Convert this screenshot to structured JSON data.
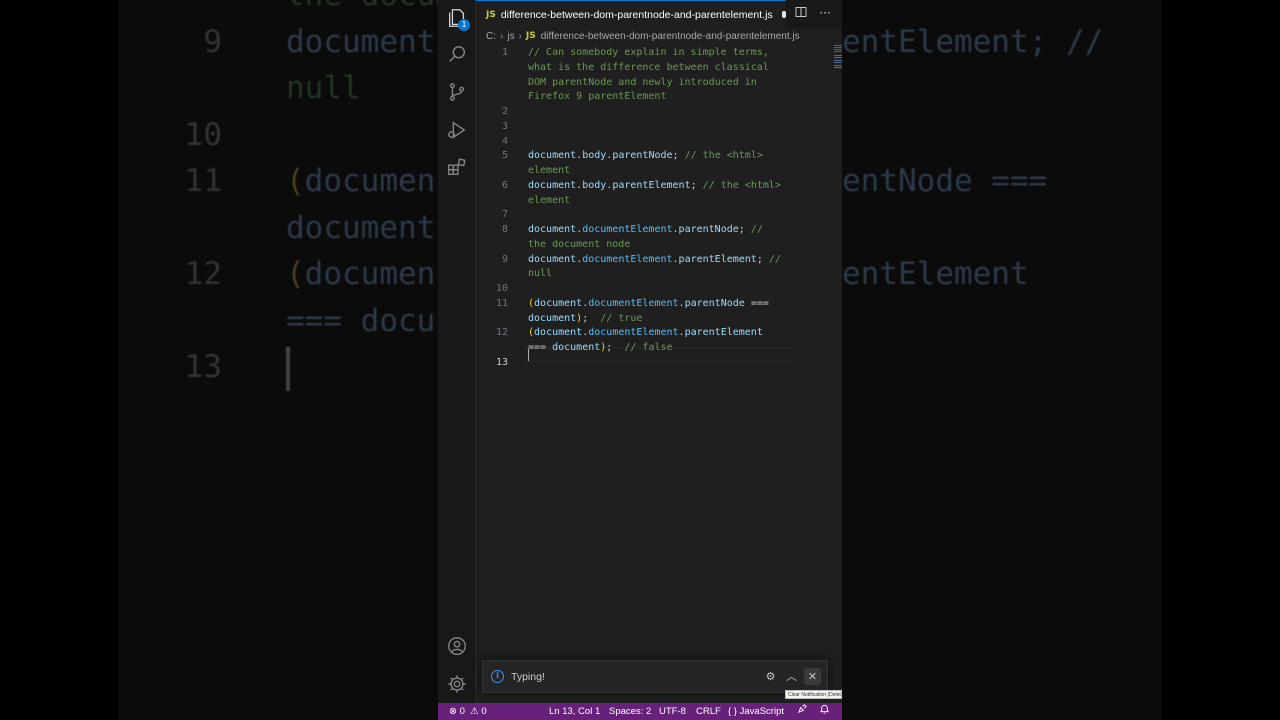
{
  "background": {
    "lines": [
      {
        "ln": "",
        "text": "the docum",
        "kind": "com"
      },
      {
        "ln": "9",
        "text": "document",
        "kind": "var"
      },
      {
        "ln": "",
        "text": "null",
        "kind": "com"
      },
      {
        "ln": "10",
        "text": "",
        "kind": "var"
      },
      {
        "ln": "11",
        "text": "(documen",
        "kind": "var"
      },
      {
        "ln": "",
        "text": "document",
        "kind": "var"
      },
      {
        "ln": "12",
        "text": "(documen",
        "kind": "var"
      },
      {
        "ln": "",
        "text": "=== docu",
        "kind": "var"
      },
      {
        "ln": "13",
        "text": "",
        "kind": "cursor"
      }
    ],
    "right_lines": [
      "",
      "entElement; //",
      "",
      "",
      "entNode ===",
      "",
      "entElement",
      "",
      ""
    ]
  },
  "tab": {
    "lang_badge": "JS",
    "title": "difference-between-dom-parentnode-and-parentelement.js",
    "split_icon": "split-editor-icon",
    "more_icon": "more-actions-icon"
  },
  "breadcrumb": {
    "drive": "C:",
    "folder": "js",
    "lang_badge": "JS",
    "file": "difference-between-dom-parentnode-and-parentelement.js"
  },
  "activity_bar": {
    "explorer_badge": "1",
    "icons": [
      "explorer-icon",
      "search-icon",
      "source-control-icon",
      "run-debug-icon",
      "extensions-icon"
    ],
    "bottom_icons": [
      "account-icon",
      "manage-gear-icon"
    ]
  },
  "editor": {
    "lines": [
      {
        "ln": "1",
        "tokens": [
          {
            "t": "// Can somebody explain in simple terms,",
            "c": "com"
          }
        ]
      },
      {
        "ln": "",
        "tokens": [
          {
            "t": "what is the difference between classical",
            "c": "com"
          }
        ]
      },
      {
        "ln": "",
        "tokens": [
          {
            "t": "DOM parentNode and newly introduced in",
            "c": "com"
          }
        ]
      },
      {
        "ln": "",
        "tokens": [
          {
            "t": "Firefox 9 parentElement",
            "c": "com"
          }
        ]
      },
      {
        "ln": "2",
        "tokens": []
      },
      {
        "ln": "3",
        "tokens": []
      },
      {
        "ln": "4",
        "tokens": []
      },
      {
        "ln": "5",
        "tokens": [
          {
            "t": "document",
            "c": "var"
          },
          {
            "t": ".",
            "c": "pun"
          },
          {
            "t": "body",
            "c": "var"
          },
          {
            "t": ".",
            "c": "pun"
          },
          {
            "t": "parentNode",
            "c": "pl"
          },
          {
            "t": "; ",
            "c": "pun"
          },
          {
            "t": "// the <html>",
            "c": "com"
          }
        ]
      },
      {
        "ln": "",
        "tokens": [
          {
            "t": "element",
            "c": "com"
          }
        ]
      },
      {
        "ln": "6",
        "tokens": [
          {
            "t": "document",
            "c": "var"
          },
          {
            "t": ".",
            "c": "pun"
          },
          {
            "t": "body",
            "c": "var"
          },
          {
            "t": ".",
            "c": "pun"
          },
          {
            "t": "parentElement",
            "c": "pl"
          },
          {
            "t": "; ",
            "c": "pun"
          },
          {
            "t": "// the <html>",
            "c": "com"
          }
        ]
      },
      {
        "ln": "",
        "tokens": [
          {
            "t": "element",
            "c": "com"
          }
        ]
      },
      {
        "ln": "7",
        "tokens": []
      },
      {
        "ln": "8",
        "tokens": [
          {
            "t": "document",
            "c": "var"
          },
          {
            "t": ".",
            "c": "pun"
          },
          {
            "t": "documentElement",
            "c": "prop"
          },
          {
            "t": ".",
            "c": "pun"
          },
          {
            "t": "parentNode",
            "c": "pl"
          },
          {
            "t": "; ",
            "c": "pun"
          },
          {
            "t": "//",
            "c": "com"
          }
        ]
      },
      {
        "ln": "",
        "tokens": [
          {
            "t": "the document node",
            "c": "com"
          }
        ]
      },
      {
        "ln": "9",
        "tokens": [
          {
            "t": "document",
            "c": "var"
          },
          {
            "t": ".",
            "c": "pun"
          },
          {
            "t": "documentElement",
            "c": "prop"
          },
          {
            "t": ".",
            "c": "pun"
          },
          {
            "t": "parentElement",
            "c": "pl"
          },
          {
            "t": "; ",
            "c": "pun"
          },
          {
            "t": "//",
            "c": "com"
          }
        ]
      },
      {
        "ln": "",
        "tokens": [
          {
            "t": "null",
            "c": "com"
          }
        ]
      },
      {
        "ln": "10",
        "tokens": []
      },
      {
        "ln": "11",
        "tokens": [
          {
            "t": "(",
            "c": "par"
          },
          {
            "t": "document",
            "c": "var"
          },
          {
            "t": ".",
            "c": "pun"
          },
          {
            "t": "documentElement",
            "c": "prop"
          },
          {
            "t": ".",
            "c": "pun"
          },
          {
            "t": "parentNode",
            "c": "pl"
          },
          {
            "t": " ===",
            "c": "pun"
          }
        ]
      },
      {
        "ln": "",
        "tokens": [
          {
            "t": "document",
            "c": "var"
          },
          {
            "t": ")",
            "c": "par"
          },
          {
            "t": ";  ",
            "c": "pun"
          },
          {
            "t": "// true",
            "c": "com"
          }
        ]
      },
      {
        "ln": "12",
        "tokens": [
          {
            "t": "(",
            "c": "par"
          },
          {
            "t": "document",
            "c": "var"
          },
          {
            "t": ".",
            "c": "pun"
          },
          {
            "t": "documentElement",
            "c": "prop"
          },
          {
            "t": ".",
            "c": "pun"
          },
          {
            "t": "parentElement",
            "c": "pl"
          }
        ]
      },
      {
        "ln": "",
        "tokens": [
          {
            "t": "=== ",
            "c": "pun"
          },
          {
            "t": "document",
            "c": "var"
          },
          {
            "t": ")",
            "c": "par"
          },
          {
            "t": ";  ",
            "c": "pun"
          },
          {
            "t": "// false",
            "c": "com"
          }
        ]
      },
      {
        "ln": "13",
        "tokens": [],
        "active": true
      }
    ]
  },
  "notification": {
    "message": "Typing!",
    "info_icon": "info-icon",
    "settings_icon": "gear-icon",
    "expand_icon": "chevron-up-icon",
    "close_icon": "close-icon",
    "close_tooltip": "Clear Notification (Delete)"
  },
  "status_bar": {
    "errors": "0",
    "warnings": "0",
    "position": "Ln 13, Col 1",
    "spaces": "Spaces: 2",
    "encoding": "UTF-8",
    "eol": "CRLF",
    "language": "JavaScript",
    "language_glyph": "{ }",
    "color": "#68217a"
  }
}
